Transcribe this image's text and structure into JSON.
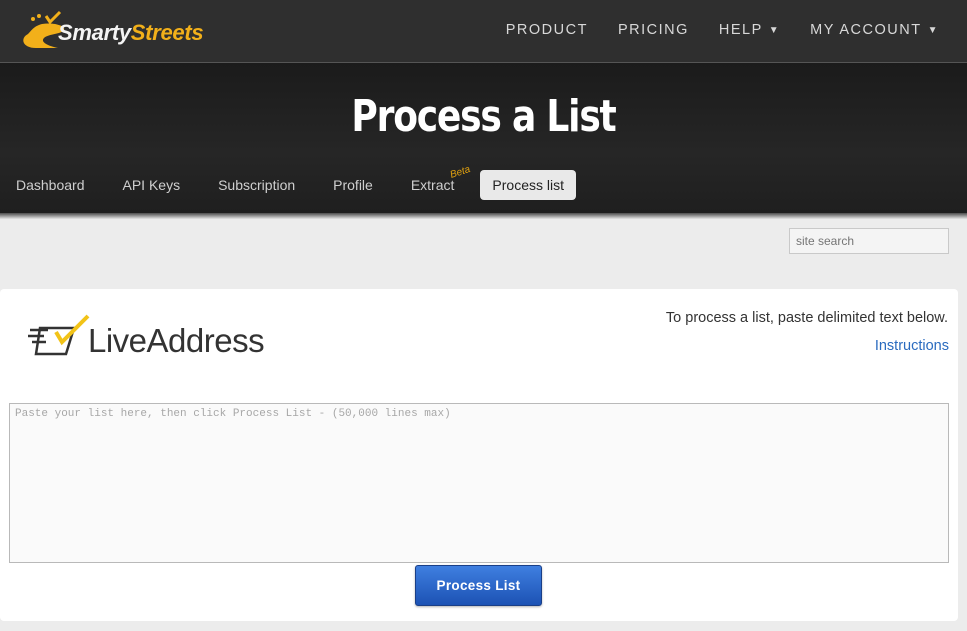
{
  "brand": {
    "name_part1": "Smarty",
    "name_part2": "Streets"
  },
  "nav": {
    "items": [
      {
        "label": "PRODUCT",
        "dropdown": false
      },
      {
        "label": "PRICING",
        "dropdown": false
      },
      {
        "label": "HELP",
        "dropdown": true
      },
      {
        "label": "MY ACCOUNT",
        "dropdown": true
      }
    ]
  },
  "hero": {
    "title": "Process a List"
  },
  "tabs": {
    "items": [
      {
        "label": "Dashboard"
      },
      {
        "label": "API Keys"
      },
      {
        "label": "Subscription"
      },
      {
        "label": "Profile"
      },
      {
        "label": "Extract",
        "badge": "Beta"
      },
      {
        "label": "Process list",
        "active": true
      }
    ]
  },
  "search": {
    "placeholder": "site search"
  },
  "panel": {
    "product_logo": "LiveAddress",
    "intro_text": "To process a list, paste delimited text below.",
    "instructions_link": "Instructions",
    "textarea_placeholder": "Paste your list here, then click Process List - (50,000 lines max)",
    "submit_label": "Process List"
  },
  "colors": {
    "accent_yellow": "#f2b01a",
    "button_blue": "#2a61c4",
    "link_blue": "#2a6bbf"
  }
}
